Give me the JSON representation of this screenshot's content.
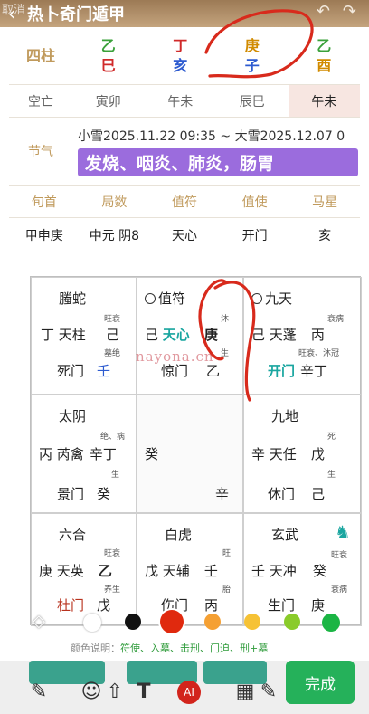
{
  "header": {
    "left_text": "取消",
    "title": "热卜奇门遁甲"
  },
  "pillars": {
    "label": "四柱",
    "cols": [
      {
        "top": "乙",
        "bottom": "巳"
      },
      {
        "top": "丁",
        "bottom": "亥"
      },
      {
        "top": "庚",
        "bottom": "子"
      },
      {
        "top": "乙",
        "bottom": "酉"
      }
    ]
  },
  "kongwang": {
    "label": "空亡",
    "values": [
      "寅卯",
      "午未",
      "辰巳",
      "午未"
    ]
  },
  "jieqi": {
    "label": "节气",
    "text": "小雪2025.11.22 09:35 ~ 大雪2025.12.07 0",
    "banner": "发烧、咽炎、肺炎，肠胃"
  },
  "table": {
    "headers": [
      "旬首",
      "局数",
      "值符",
      "值使",
      "马星"
    ],
    "values": [
      "甲申庚",
      "中元 阴8",
      "天心",
      "开门",
      "亥"
    ]
  },
  "palaces": {
    "p1": {
      "god": "螣蛇",
      "s1": "旺衰",
      "line1": [
        "丁",
        "天柱",
        "己"
      ],
      "s2": "墓绝",
      "line2": [
        "死门",
        "壬"
      ]
    },
    "p2": {
      "god": "值符",
      "s1": "沐",
      "line1": [
        "己",
        "天心",
        "庚"
      ],
      "s2": "生",
      "line2": [
        "惊门",
        "乙"
      ]
    },
    "p3": {
      "god": "九天",
      "s1": "衰病",
      "line1": [
        "己",
        "天蓬",
        "丙"
      ],
      "s2": "旺衰、沐冠",
      "line2": [
        "开门",
        "辛丁"
      ]
    },
    "p4": {
      "god": "太阴",
      "s1": "绝、病",
      "line1": [
        "丙",
        "芮禽",
        "辛丁"
      ],
      "s2": "生",
      "line2": [
        "景门",
        "癸"
      ]
    },
    "p5": {
      "line1": "癸",
      "line2": "辛"
    },
    "p6": {
      "god": "九地",
      "s1": "死",
      "line1": [
        "辛",
        "天任",
        "戊"
      ],
      "s2": "生",
      "line2": [
        "休门",
        "己"
      ]
    },
    "p7": {
      "god": "六合",
      "s1": "旺衰",
      "line1": [
        "庚",
        "天英",
        "乙"
      ],
      "s2": "养生",
      "line2": [
        "杜门",
        "戊"
      ]
    },
    "p8": {
      "god": "白虎",
      "s1": "旺",
      "line1": [
        "戊",
        "天辅",
        "壬"
      ],
      "s2": "胎",
      "line2": [
        "伤门",
        "丙"
      ]
    },
    "p9": {
      "god": "玄武",
      "s1": "旺衰",
      "line1": [
        "壬",
        "天冲",
        "癸"
      ],
      "s2": "衰病",
      "line2": [
        "生门",
        "庚"
      ]
    }
  },
  "legend": {
    "prefix": "颜色说明：",
    "items": "符使、入墓、击刑、门迫、刑+墓"
  },
  "watermark": "nayona.cn",
  "done_label": "完成",
  "colors": {
    "accent": "#9b6cdd",
    "done": "#25b15a",
    "header": "#b08d66"
  }
}
